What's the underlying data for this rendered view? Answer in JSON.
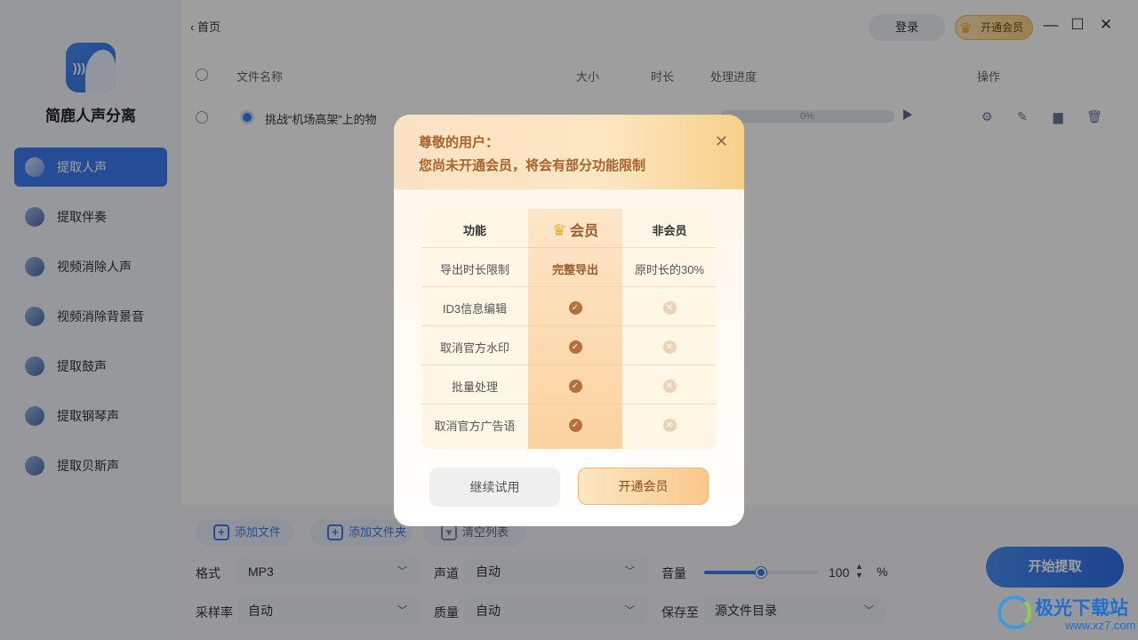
{
  "app": {
    "name": "简鹿人声分离"
  },
  "sidebar": {
    "items": [
      {
        "label": "提取人声",
        "active": true
      },
      {
        "label": "提取伴奏"
      },
      {
        "label": "视频消除人声"
      },
      {
        "label": "视频消除背景音"
      },
      {
        "label": "提取鼓声"
      },
      {
        "label": "提取钢琴声"
      },
      {
        "label": "提取贝斯声"
      }
    ]
  },
  "topbar": {
    "back_label": "首页",
    "login_label": "登录",
    "vip_label": "开通会员"
  },
  "table": {
    "headers": {
      "name": "文件名称",
      "size": "大小",
      "duration": "时长",
      "progress": "处理进度",
      "actions": "操作"
    },
    "rows": [
      {
        "name": "挑战“机场高架”上的物",
        "progress": "0%"
      }
    ]
  },
  "bottom": {
    "add_file": "添加文件",
    "add_folder": "添加文件夹",
    "clear_list": "清空列表",
    "format_label": "格式",
    "format_value": "MP3",
    "channel_label": "声道",
    "channel_value": "自动",
    "volume_label": "音量",
    "volume_value": "100",
    "volume_unit": "%",
    "volume_level": 0.5,
    "samplerate_label": "采样率",
    "samplerate_value": "自动",
    "quality_label": "质量",
    "quality_value": "自动",
    "saveto_label": "保存至",
    "saveto_value": "源文件目录",
    "start_label": "开始提取"
  },
  "dialog": {
    "title_line1": "尊敬的用户：",
    "title_line2": "您尚未开通会员，将会有部分功能限制",
    "table_header": {
      "feature": "功能",
      "vip": "会员",
      "nonvip": "非会员"
    },
    "rows": [
      {
        "feature": "导出时长限制",
        "vip": "完整导出",
        "nonvip": "原时长的30%"
      },
      {
        "feature": "ID3信息编辑",
        "vip": "check",
        "nonvip": "cross"
      },
      {
        "feature": "取消官方水印",
        "vip": "check",
        "nonvip": "cross"
      },
      {
        "feature": "批量处理",
        "vip": "check",
        "nonvip": "cross"
      },
      {
        "feature": "取消官方广告语",
        "vip": "check",
        "nonvip": "cross"
      }
    ],
    "trial_label": "继续试用",
    "open_vip_label": "开通会员"
  },
  "watermark": {
    "text": "极光下载站",
    "url": "www.xz7.com"
  },
  "colors": {
    "accent": "#3d7cf0",
    "vip_gold": "#f0ad2f",
    "vip_brown": "#a8622b"
  }
}
